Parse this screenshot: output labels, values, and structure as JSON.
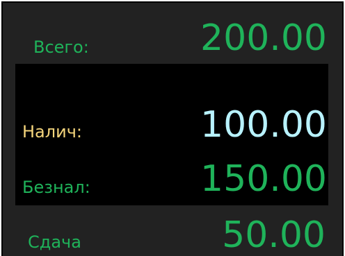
{
  "rows": {
    "total": {
      "label": "Всего:",
      "value": "200.00"
    },
    "cash": {
      "label": "Налич:",
      "value": "100.00"
    },
    "card": {
      "label": "Безнал:",
      "value": "150.00"
    },
    "change": {
      "label": "Сдача",
      "value": "50.00"
    }
  },
  "colors": {
    "panel_bg": "#222222",
    "band_bg": "#000000",
    "green": "#1fb35a",
    "cash_label": "#f5d57c",
    "cash_value": "#b8f2ff"
  }
}
